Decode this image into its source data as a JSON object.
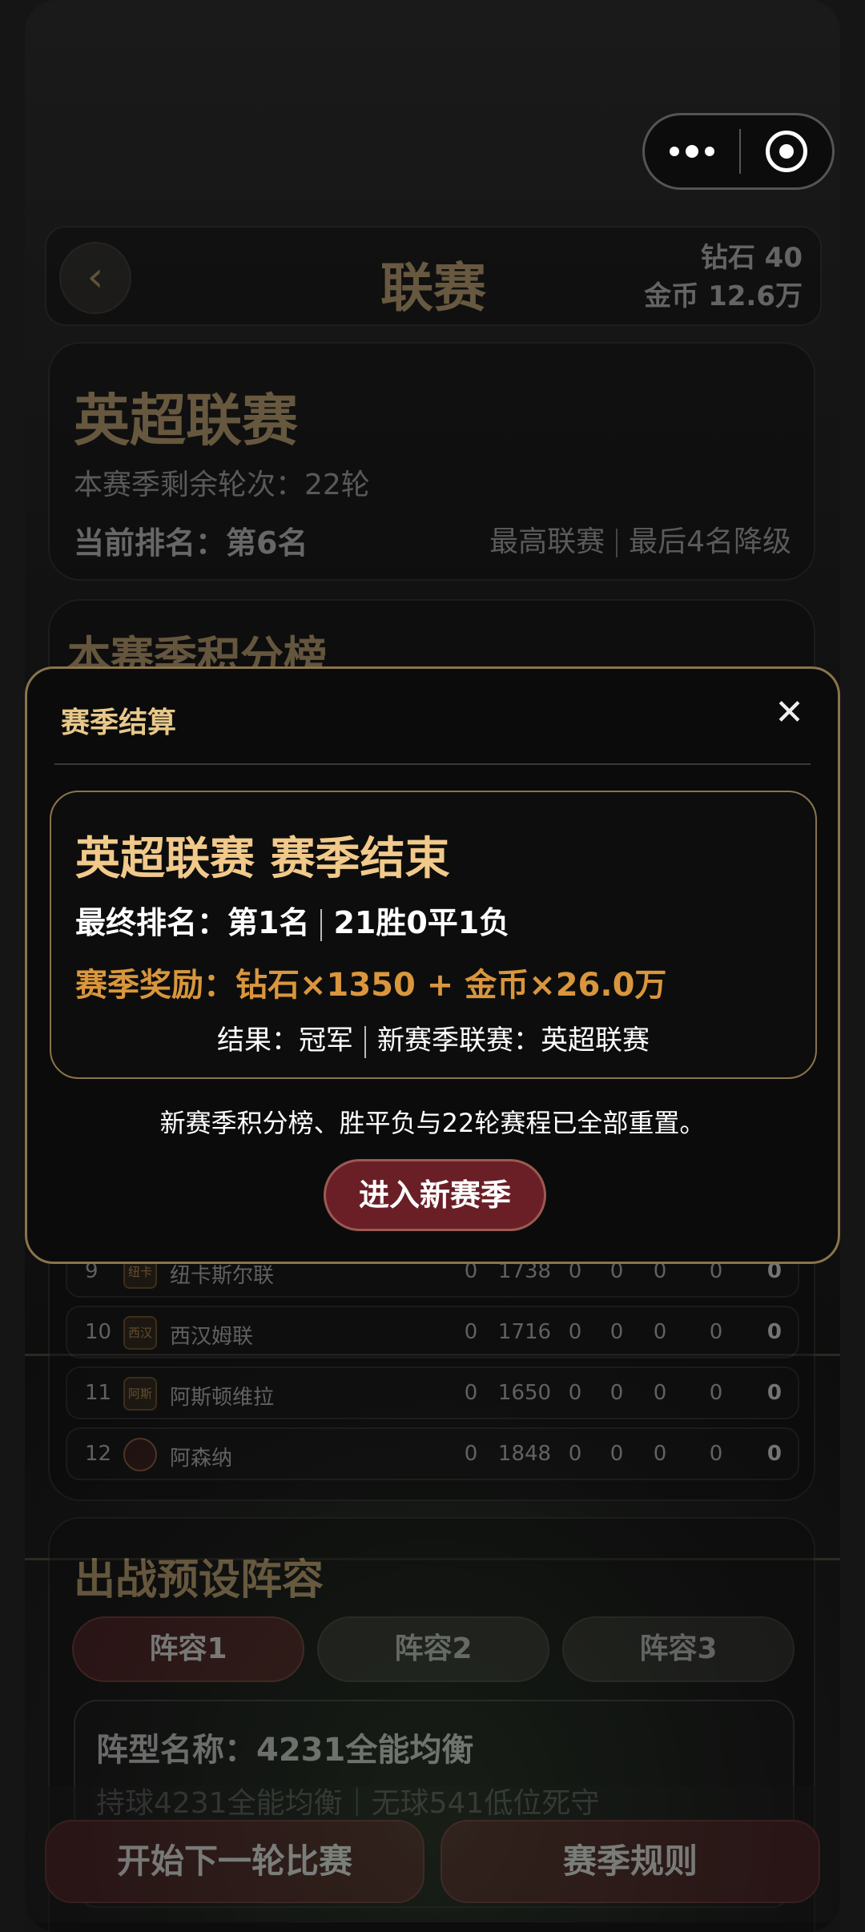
{
  "status_capsule": {
    "more_icon": "dots-icon",
    "record_icon": "target-icon"
  },
  "header": {
    "back_icon": "‹",
    "title": "联赛",
    "diamond": "钻石 40",
    "gold": "金币 12.6万"
  },
  "league": {
    "name": "英超联赛",
    "remaining_rounds": "本赛季剩余轮次：22轮",
    "current_rank": "当前排名：第6名",
    "tag_top": "最高联赛",
    "tag_relegation": "最后4名降级"
  },
  "standings": {
    "title": "本赛季积分榜",
    "rows": [
      {
        "rank": "9",
        "badge": "纽卡",
        "team": "纽卡斯尔联",
        "played": "0",
        "rating": "1738",
        "w": "0",
        "d": "0",
        "l": "0",
        "gd": "0",
        "pts": "0"
      },
      {
        "rank": "10",
        "badge": "西汉",
        "team": "西汉姆联",
        "played": "0",
        "rating": "1716",
        "w": "0",
        "d": "0",
        "l": "0",
        "gd": "0",
        "pts": "0"
      },
      {
        "rank": "11",
        "badge": "阿斯",
        "team": "阿斯顿维拉",
        "played": "0",
        "rating": "1650",
        "w": "0",
        "d": "0",
        "l": "0",
        "gd": "0",
        "pts": "0"
      },
      {
        "rank": "12",
        "badge": "",
        "team": "阿森纳",
        "played": "0",
        "rating": "1848",
        "w": "0",
        "d": "0",
        "l": "0",
        "gd": "0",
        "pts": "0"
      }
    ]
  },
  "lineup": {
    "title": "出战预设阵容",
    "tabs": [
      "阵容1",
      "阵容2",
      "阵容3"
    ],
    "formation_name": "阵型名称：4231全能均衡",
    "formation_sub": "持球4231全能均衡｜无球541低位死守"
  },
  "bottom": {
    "next_match": "开始下一轮比赛",
    "rules": "赛季规则"
  },
  "modal": {
    "title": "赛季结算",
    "close_icon": "✕",
    "result_title": "英超联赛 赛季结束",
    "final_rank": "最终排名：第1名",
    "record": "21胜0平1负",
    "reward": "赛季奖励：钻石×1350 + 金币×26.0万",
    "outcome": "结果：冠军",
    "next_league": "新赛季联赛：英超联赛",
    "note": "新赛季积分榜、胜平负与22轮赛程已全部重置。",
    "enter_button": "进入新赛季"
  }
}
